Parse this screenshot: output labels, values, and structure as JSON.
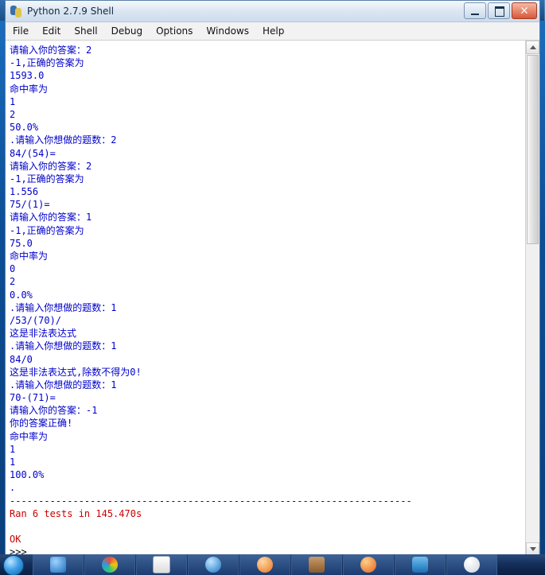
{
  "window": {
    "title": "Python 2.7.9 Shell",
    "icon": "python-logo-icon",
    "buttons": {
      "minimize": "minimize-button",
      "maximize": "maximize-button",
      "close": "×"
    }
  },
  "menubar": {
    "items": [
      {
        "label": "File"
      },
      {
        "label": "Edit"
      },
      {
        "label": "Shell"
      },
      {
        "label": "Debug"
      },
      {
        "label": "Options"
      },
      {
        "label": "Windows"
      },
      {
        "label": "Help"
      }
    ]
  },
  "console": {
    "lines": [
      {
        "text": "请输入你的答案：2",
        "color": "blue"
      },
      {
        "text": "-1,正确的答案为",
        "color": "blue"
      },
      {
        "text": "1593.0",
        "color": "blue"
      },
      {
        "text": "命中率为",
        "color": "blue"
      },
      {
        "text": "1",
        "color": "blue"
      },
      {
        "text": "2",
        "color": "blue"
      },
      {
        "text": "50.0%",
        "color": "blue"
      },
      {
        "text": ".请输入你想做的题数：2",
        "color": "blue"
      },
      {
        "text": "84/(54)=",
        "color": "blue"
      },
      {
        "text": "请输入你的答案：2",
        "color": "blue"
      },
      {
        "text": "-1,正确的答案为",
        "color": "blue"
      },
      {
        "text": "1.556",
        "color": "blue"
      },
      {
        "text": "75/(1)=",
        "color": "blue"
      },
      {
        "text": "请输入你的答案：1",
        "color": "blue"
      },
      {
        "text": "-1,正确的答案为",
        "color": "blue"
      },
      {
        "text": "75.0",
        "color": "blue"
      },
      {
        "text": "命中率为",
        "color": "blue"
      },
      {
        "text": "0",
        "color": "blue"
      },
      {
        "text": "2",
        "color": "blue"
      },
      {
        "text": "0.0%",
        "color": "blue"
      },
      {
        "text": ".请输入你想做的题数：1",
        "color": "blue"
      },
      {
        "text": "/53/(70)/",
        "color": "blue"
      },
      {
        "text": "这是非法表达式",
        "color": "blue"
      },
      {
        "text": ".请输入你想做的题数：1",
        "color": "blue"
      },
      {
        "text": "84/0",
        "color": "blue"
      },
      {
        "text": "这是非法表达式,除数不得为0!",
        "color": "blue"
      },
      {
        "text": ".请输入你想做的题数：1",
        "color": "blue"
      },
      {
        "text": "70-(71)=",
        "color": "blue"
      },
      {
        "text": "请输入你的答案：-1",
        "color": "blue"
      },
      {
        "text": "你的答案正确!",
        "color": "blue"
      },
      {
        "text": "命中率为",
        "color": "blue"
      },
      {
        "text": "1",
        "color": "blue"
      },
      {
        "text": "1",
        "color": "blue"
      },
      {
        "text": "100.0%",
        "color": "blue"
      },
      {
        "text": ".",
        "color": "blue"
      },
      {
        "text": "----------------------------------------------------------------------",
        "color": "blue"
      },
      {
        "text": "Ran 6 tests in 145.470s",
        "color": "red"
      },
      {
        "text": "",
        "color": "black"
      },
      {
        "text": "OK",
        "color": "red"
      },
      {
        "text": ">>>",
        "color": "black"
      }
    ]
  },
  "scrollbar": {
    "up_arrow": "scroll-up-icon",
    "down_arrow": "scroll-down-icon"
  },
  "taskbar": {
    "start": "start-orb",
    "items": [
      {
        "icon": "window-blue-icon"
      },
      {
        "icon": "colorful-circle-icon"
      },
      {
        "icon": "notepad-icon"
      },
      {
        "icon": "internet-explorer-icon"
      },
      {
        "icon": "orange-app-icon"
      },
      {
        "icon": "brown-app-icon"
      },
      {
        "icon": "firefox-icon"
      },
      {
        "icon": "c-app-icon"
      },
      {
        "icon": "python-app-icon"
      }
    ]
  }
}
